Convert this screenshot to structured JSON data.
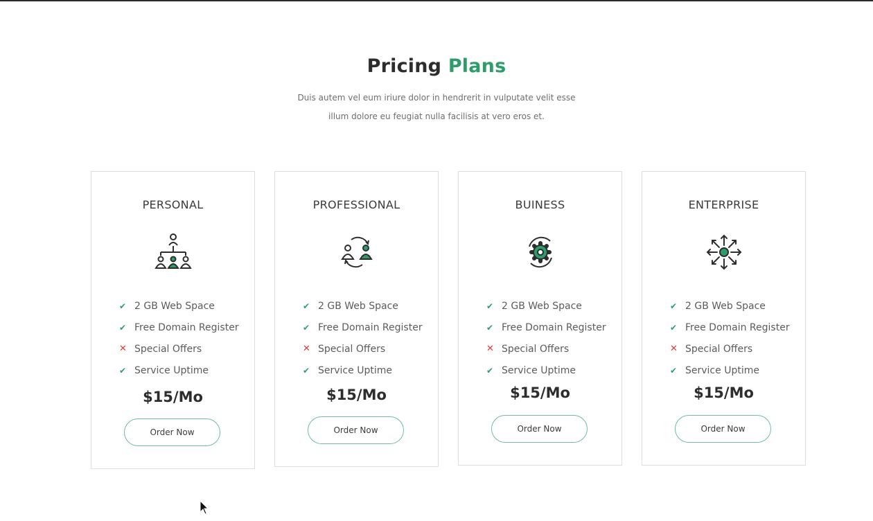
{
  "header": {
    "title_main": "Pricing",
    "title_accent": "Plans",
    "desc_line1": "Duis autem vel eum iriure dolor in hendrerit in vulputate velit esse",
    "desc_line2": "illum dolore eu feugiat nulla facilisis at vero eros et."
  },
  "colors": {
    "accent": "#2f9d6a",
    "cross": "#e53935",
    "text": "#2d2d2d"
  },
  "plans": [
    {
      "name": "PERSONAL",
      "icon": "team-hierarchy-icon",
      "features": [
        {
          "label": "2 GB Web Space",
          "included": true,
          "symbol": "✔"
        },
        {
          "label": "Free Domain Register",
          "included": true,
          "symbol": "✔"
        },
        {
          "label": "Special Offers",
          "included": false,
          "symbol": "✕"
        },
        {
          "label": "Service Uptime",
          "included": true,
          "symbol": "✔"
        }
      ],
      "price": "$15/Mo",
      "button": "Order Now"
    },
    {
      "name": "PROFESSIONAL",
      "icon": "user-exchange-icon",
      "features": [
        {
          "label": "2 GB Web Space",
          "included": true,
          "symbol": "✔"
        },
        {
          "label": "Free Domain Register",
          "included": true,
          "symbol": "✔"
        },
        {
          "label": "Special Offers",
          "included": false,
          "symbol": "✕"
        },
        {
          "label": "Service Uptime",
          "included": true,
          "symbol": "✔"
        }
      ],
      "price": "$15/Mo",
      "button": "Order Now"
    },
    {
      "name": "BUINESS",
      "icon": "gear-refresh-icon",
      "features": [
        {
          "label": "2 GB Web Space",
          "included": true,
          "symbol": "✔"
        },
        {
          "label": "Free Domain Register",
          "included": true,
          "symbol": "✔"
        },
        {
          "label": "Special Offers",
          "included": false,
          "symbol": "✕"
        },
        {
          "label": "Service Uptime",
          "included": true,
          "symbol": "✔"
        }
      ],
      "price": "$15/Mo",
      "button": "Order Now"
    },
    {
      "name": "ENTERPRISE",
      "icon": "hub-expand-icon",
      "features": [
        {
          "label": "2 GB Web Space",
          "included": true,
          "symbol": "✔"
        },
        {
          "label": "Free Domain Register",
          "included": true,
          "symbol": "✔"
        },
        {
          "label": "Special Offers",
          "included": false,
          "symbol": "✕"
        },
        {
          "label": "Service Uptime",
          "included": true,
          "symbol": "✔"
        }
      ],
      "price": "$15/Mo",
      "button": "Order Now"
    }
  ]
}
